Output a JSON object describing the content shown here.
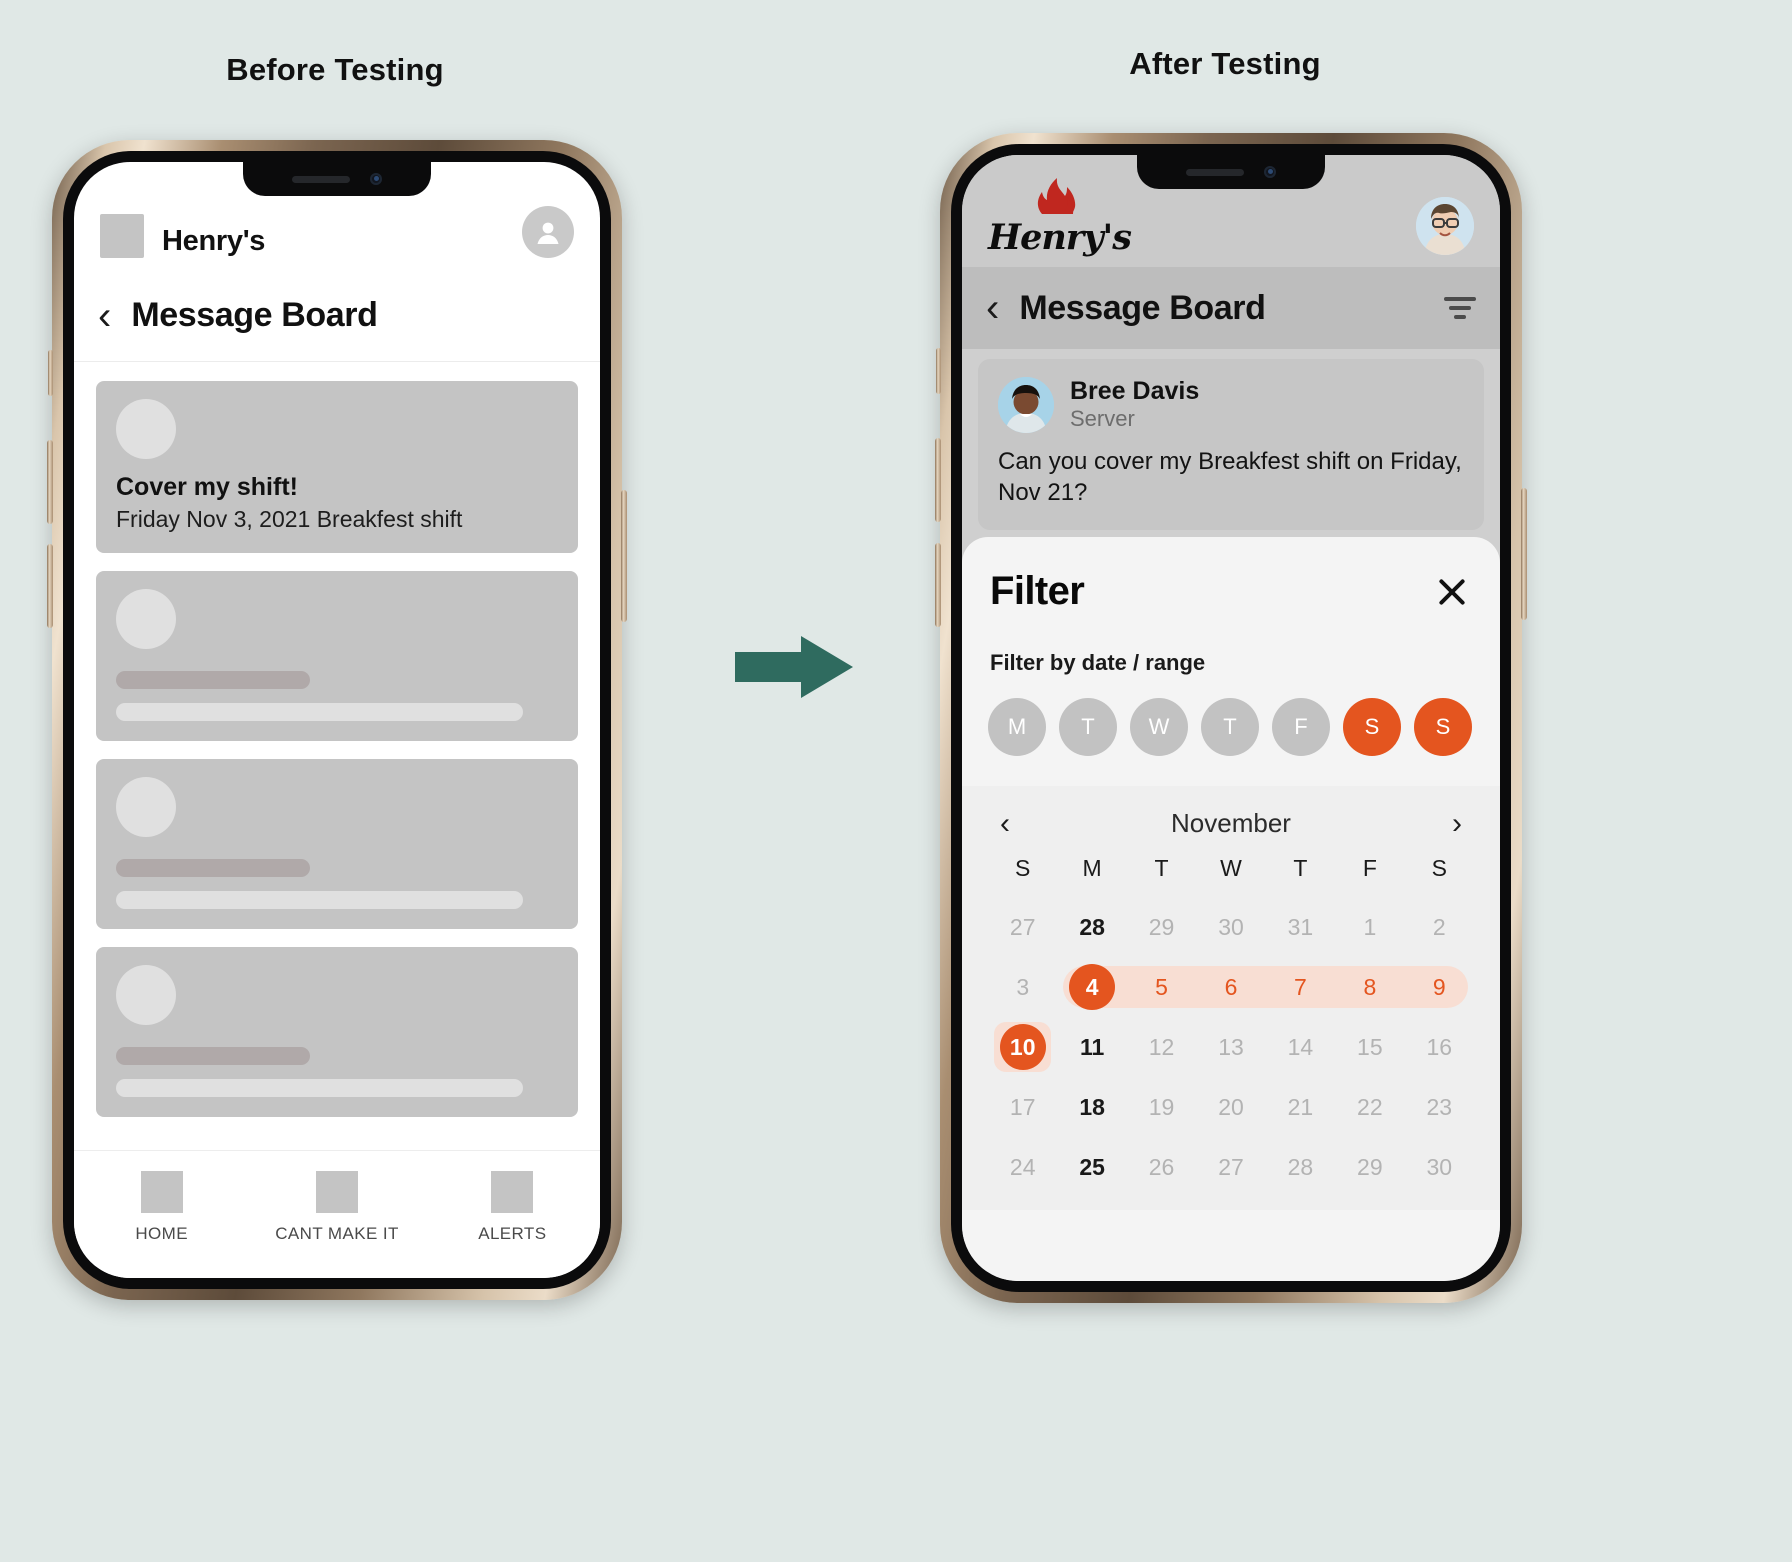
{
  "captions": {
    "before": "Before Testing",
    "after": "After Testing"
  },
  "colors": {
    "page_background": "#e0e8e6",
    "arrow": "#2f6b5f",
    "accent_orange": "#e4551f",
    "range_tint": "#f8ded3",
    "wireframe_gray": "#c4c4c4",
    "flame_red": "#c0271f"
  },
  "arrow": {
    "name": "right-arrow",
    "direction": "right"
  },
  "before_phone": {
    "brand": {
      "name": "Henry's",
      "logo": "placeholder-square",
      "avatar": "person-icon"
    },
    "nav": {
      "back": "back-chevron",
      "title": "Message Board"
    },
    "cards": [
      {
        "title": "Cover my shift!",
        "subtitle": "Friday Nov 3, 2021 Breakfest shift",
        "has_avatar": true,
        "placeholder_bars": []
      },
      {
        "title": "",
        "subtitle": "",
        "has_avatar": true,
        "placeholder_bars": [
          "dark",
          "light"
        ]
      },
      {
        "title": "",
        "subtitle": "",
        "has_avatar": true,
        "placeholder_bars": [
          "dark",
          "light"
        ]
      },
      {
        "title": "",
        "subtitle": "",
        "has_avatar": true,
        "placeholder_bars": [
          "dark",
          "light"
        ]
      }
    ],
    "tabbar": [
      {
        "label": "HOME",
        "icon": "home-icon"
      },
      {
        "label": "CANT MAKE IT",
        "icon": "calendar-icon"
      },
      {
        "label": "ALERTS",
        "icon": "bell-icon"
      }
    ]
  },
  "after_phone": {
    "brand": {
      "name": "Henry's",
      "logo": "flame-logo",
      "avatar": "user-photo"
    },
    "nav": {
      "back": "back-chevron",
      "title": "Message Board",
      "filter": "filter-icon"
    },
    "message": {
      "author": "Bree Davis",
      "role": "Server",
      "body": "Can you cover my Breakfest shift on Friday, Nov 21?"
    },
    "filter_sheet": {
      "title": "Filter",
      "close": "close-icon",
      "section_label": "Filter by date / range",
      "day_chips": [
        {
          "label": "M",
          "selected": false
        },
        {
          "label": "T",
          "selected": false
        },
        {
          "label": "W",
          "selected": false
        },
        {
          "label": "T",
          "selected": false
        },
        {
          "label": "F",
          "selected": false
        },
        {
          "label": "S",
          "selected": true
        },
        {
          "label": "S",
          "selected": true
        }
      ],
      "calendar": {
        "month": "November",
        "prev": "chevron-left-icon",
        "next": "chevron-right-icon",
        "dow": [
          "S",
          "M",
          "T",
          "W",
          "T",
          "F",
          "S"
        ],
        "weeks": [
          [
            {
              "d": "27",
              "state": "muted"
            },
            {
              "d": "28",
              "state": "current"
            },
            {
              "d": "29",
              "state": "muted"
            },
            {
              "d": "30",
              "state": "muted"
            },
            {
              "d": "31",
              "state": "muted"
            },
            {
              "d": "1",
              "state": "muted"
            },
            {
              "d": "2",
              "state": "muted"
            }
          ],
          [
            {
              "d": "3",
              "state": "muted"
            },
            {
              "d": "4",
              "state": "range-start-selected"
            },
            {
              "d": "5",
              "state": "range"
            },
            {
              "d": "6",
              "state": "range"
            },
            {
              "d": "7",
              "state": "range"
            },
            {
              "d": "8",
              "state": "range"
            },
            {
              "d": "9",
              "state": "range-end"
            }
          ],
          [
            {
              "d": "10",
              "state": "selected-soft"
            },
            {
              "d": "11",
              "state": "current"
            },
            {
              "d": "12",
              "state": "muted"
            },
            {
              "d": "13",
              "state": "muted"
            },
            {
              "d": "14",
              "state": "muted"
            },
            {
              "d": "15",
              "state": "muted"
            },
            {
              "d": "16",
              "state": "muted"
            }
          ],
          [
            {
              "d": "17",
              "state": "muted"
            },
            {
              "d": "18",
              "state": "current"
            },
            {
              "d": "19",
              "state": "muted"
            },
            {
              "d": "20",
              "state": "muted"
            },
            {
              "d": "21",
              "state": "muted"
            },
            {
              "d": "22",
              "state": "muted"
            },
            {
              "d": "23",
              "state": "muted"
            }
          ],
          [
            {
              "d": "24",
              "state": "muted"
            },
            {
              "d": "25",
              "state": "current"
            },
            {
              "d": "26",
              "state": "muted"
            },
            {
              "d": "27",
              "state": "muted"
            },
            {
              "d": "28",
              "state": "muted"
            },
            {
              "d": "29",
              "state": "muted"
            },
            {
              "d": "30",
              "state": "muted"
            }
          ]
        ]
      }
    }
  }
}
